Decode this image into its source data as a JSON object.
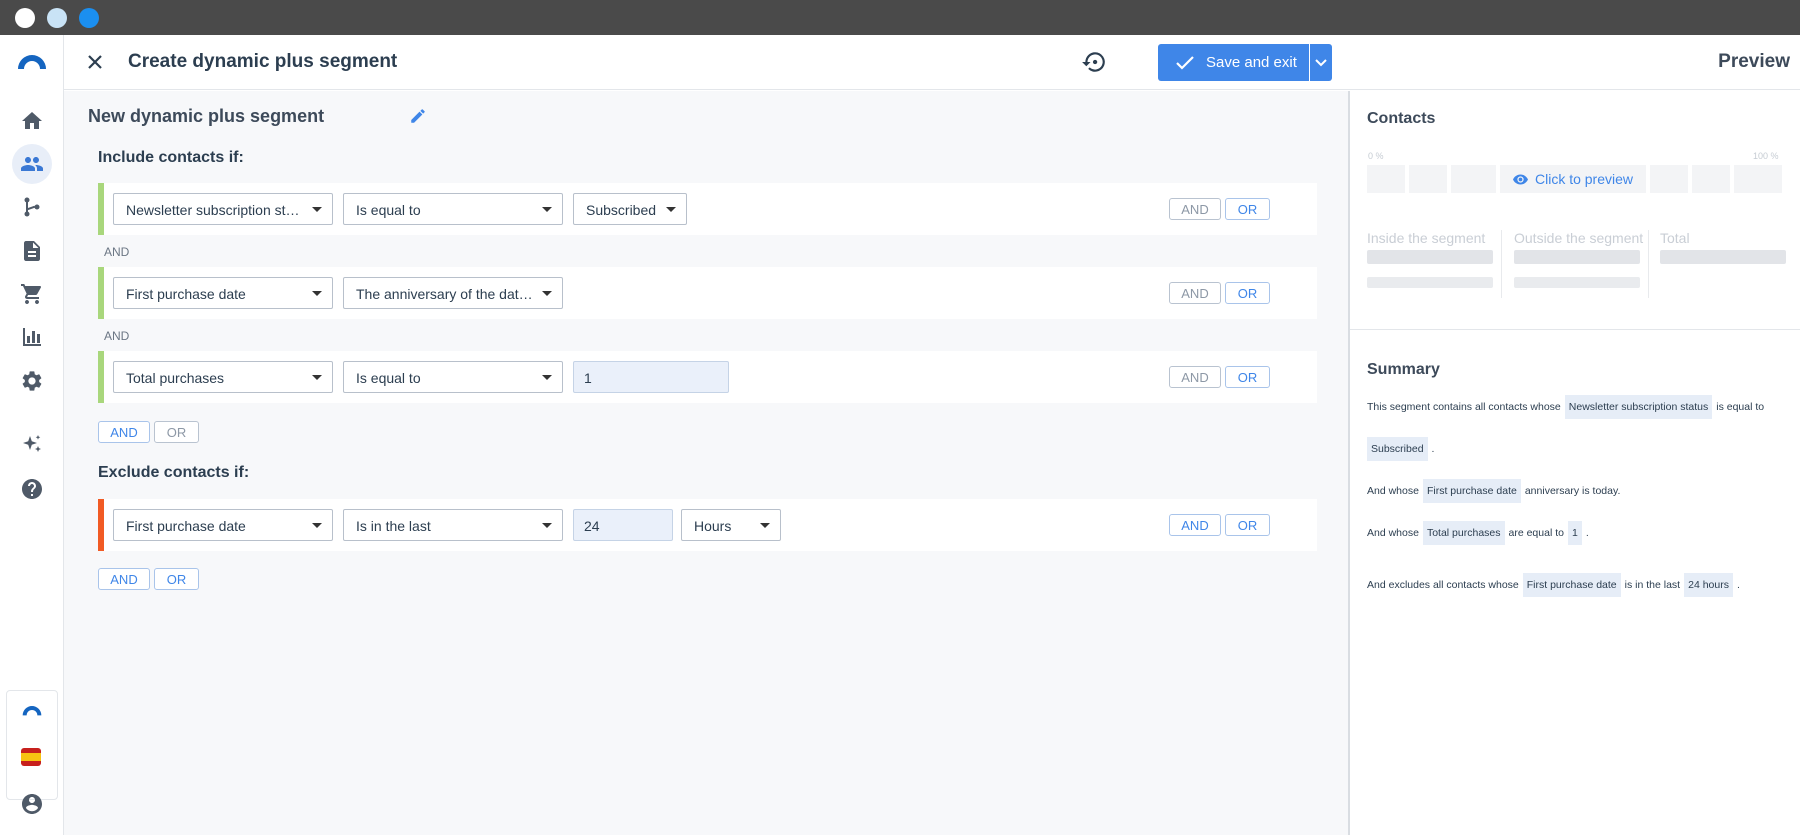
{
  "header": {
    "title": "Create dynamic plus segment",
    "save_label": "Save and exit"
  },
  "segment": {
    "name": "New dynamic plus segment"
  },
  "include": {
    "title": "Include contacts if:",
    "separator": "AND",
    "rules": [
      {
        "field": "Newsletter subscription status",
        "operator": "Is equal to",
        "value": "Subscribed"
      },
      {
        "field": "First purchase date",
        "operator": "The anniversary of the date ..."
      },
      {
        "field": "Total purchases",
        "operator": "Is equal to",
        "value": "1"
      }
    ]
  },
  "exclude": {
    "title": "Exclude contacts if:",
    "rules": [
      {
        "field": "First purchase date",
        "operator": "Is in the last",
        "value": "24",
        "unit": "Hours"
      }
    ]
  },
  "logic": {
    "and": "AND",
    "or": "OR"
  },
  "preview": {
    "title": "Preview",
    "contacts_title": "Contacts",
    "pct_min": "0 %",
    "pct_max": "100 %",
    "click_label": "Click to preview",
    "stats": [
      "Inside the segment",
      "Outside the segment",
      "Total"
    ],
    "summary_title": "Summary",
    "summary": {
      "l1_a": "This segment contains all contacts whose",
      "l1_chip": "Newsletter subscription status",
      "l1_b": "is equal to",
      "l2_chip": "Subscribed",
      "l2_b": ".",
      "l3_a": "And whose",
      "l3_chip": "First purchase date",
      "l3_b": "anniversary is today.",
      "l4_a": "And whose",
      "l4_chip": "Total purchases",
      "l4_b": "are equal to",
      "l4_chip2": "1",
      "l4_c": ".",
      "l5_a": "And excludes all contacts whose",
      "l5_chip": "First purchase date",
      "l5_b": "is in the last",
      "l5_chip2": "24 hours",
      "l5_c": "."
    }
  },
  "colors": {
    "accent": "#3f86e8",
    "include_bar": "#a9d77c",
    "exclude_bar": "#f15a24"
  },
  "icons": [
    "home-icon",
    "contacts-icon",
    "flows-icon",
    "document-icon",
    "cart-icon",
    "chart-icon",
    "gear-icon",
    "sparkle-icon",
    "help-icon",
    "user-icon"
  ]
}
